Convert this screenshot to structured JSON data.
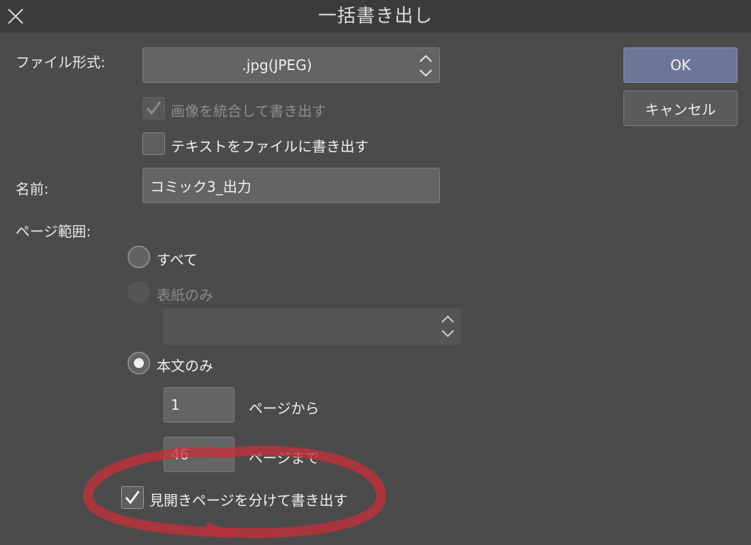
{
  "dialog": {
    "title": "一括書き出し",
    "close_icon": "close-icon"
  },
  "file_format": {
    "label": "ファイル形式:",
    "value": ".jpg(JPEG)"
  },
  "options": {
    "merge_images": {
      "label": "画像を統合して書き出す",
      "checked": true,
      "enabled": false
    },
    "export_text": {
      "label": "テキストをファイルに書き出す",
      "checked": false,
      "enabled": true
    }
  },
  "name": {
    "label": "名前:",
    "value": "コミック3_出力"
  },
  "page_range": {
    "label": "ページ範囲:",
    "all": {
      "label": "すべて",
      "selected": false
    },
    "cover_only": {
      "label": "表紙のみ",
      "selected": false,
      "enabled": false,
      "select_value": ""
    },
    "body_only": {
      "label": "本文のみ",
      "selected": true
    },
    "from_value": "1",
    "from_label": "ページから",
    "to_value": "46",
    "to_label": "ページまで"
  },
  "spread": {
    "label": "見開きページを分けて書き出す",
    "checked": true
  },
  "buttons": {
    "ok": "OK",
    "cancel": "キャンセル"
  },
  "colors": {
    "background": "#4b4b4b",
    "titlebar": "#3b3b3b",
    "ok_button": "#6c7697",
    "highlight_circle": "#c4303a"
  }
}
